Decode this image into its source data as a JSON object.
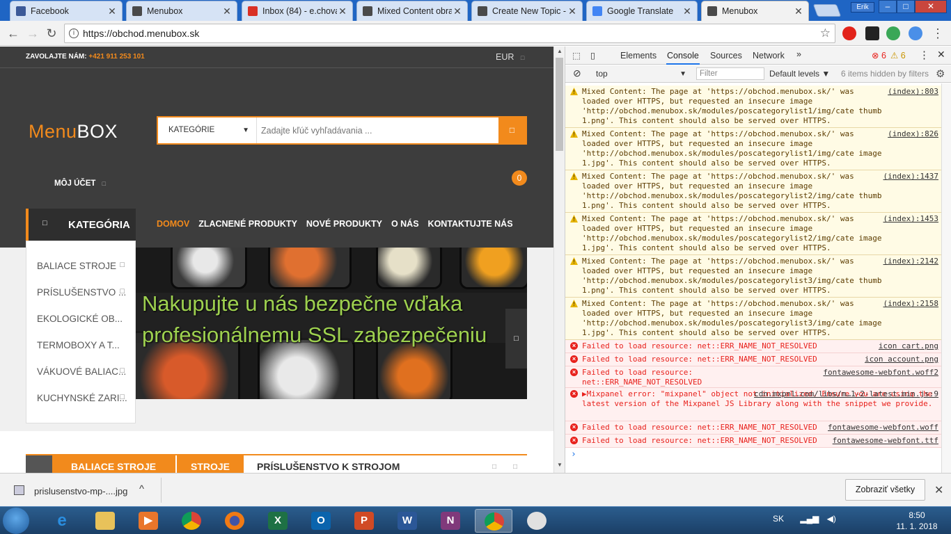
{
  "browser": {
    "tabs": [
      {
        "title": "Facebook",
        "fav_color": "#3b5998",
        "fav_icon": "facebook-icon"
      },
      {
        "title": "Menubox",
        "fav_color": "#4a4a4a",
        "fav_icon": "menubox-icon"
      },
      {
        "title": "Inbox (84) - e.chova",
        "fav_color": "#d93025",
        "fav_icon": "gmail-icon"
      },
      {
        "title": "Mixed Content obra",
        "fav_color": "#4a4a4a",
        "fav_icon": "menubox-icon"
      },
      {
        "title": "Create New Topic -",
        "fav_color": "#4a4a4a",
        "fav_icon": "menubox-icon"
      },
      {
        "title": "Google Translate",
        "fav_color": "#4285f4",
        "fav_icon": "translate-icon"
      },
      {
        "title": "Menubox",
        "fav_color": "#4a4a4a",
        "fav_icon": "menubox-icon",
        "active": true
      }
    ],
    "profile": "Erik",
    "url": "https://obchod.menubox.sk"
  },
  "site": {
    "call_label": "ZAVOLAJTE NÁM:",
    "phone": "+421 911 253 101",
    "currency": "EUR",
    "logo_part1": "Menu",
    "logo_part2": "BOX",
    "search_category": "KATEGÓRIE",
    "search_placeholder": "Zadajte kľúč vyhľadávania ...",
    "account": "MÔJ ÚČET",
    "cart_count": "0",
    "category_header": "KATEGÓRIA",
    "nav": [
      "DOMOV",
      "ZLACNENÉ PRODUKTY",
      "NOVÉ PRODUKTY",
      "O NÁS",
      "KONTAKTUJTE NÁS"
    ],
    "categories": [
      "BALIACE STROJE",
      "PRÍSLUŠENSTVO ...",
      "EKOLOGICKÉ OB...",
      "TERMOBOXY A T...",
      "VÁKUOVÉ BALIAC...",
      "KUCHYNSKÉ ZARI..."
    ],
    "hero_line1": "Nakupujte u nás bezpečne vďaka",
    "hero_line2": "profesionálnemu SSL zabezpečeniu",
    "product_tabs": [
      "BALIACE STROJE",
      "STROJE",
      "PRÍSLUŠENSTVO K STROJOM"
    ],
    "accent": "#f28a1c"
  },
  "devtools": {
    "tabs": [
      "Elements",
      "Console",
      "Sources",
      "Network"
    ],
    "error_count": "6",
    "warning_count": "6",
    "context": "top",
    "filter_placeholder": "Filter",
    "levels": "Default levels",
    "hidden": "6 items hidden by filters",
    "messages": [
      {
        "type": "warn",
        "text": "Mixed Content: The page at 'https://obchod.menubox.sk/' was loaded over HTTPS, but requested an insecure image 'http://obchod.menubox.sk/modules/poscategorylist1/img/cate thumb 1.png'. This content should also be served over HTTPS.",
        "src": "(index):803"
      },
      {
        "type": "warn",
        "text": "Mixed Content: The page at 'https://obchod.menubox.sk/' was loaded over HTTPS, but requested an insecure image 'http://obchod.menubox.sk/modules/poscategorylist1/img/cate image 1.jpg'. This content should also be served over HTTPS.",
        "src": "(index):826"
      },
      {
        "type": "warn",
        "text": "Mixed Content: The page at 'https://obchod.menubox.sk/' was loaded over HTTPS, but requested an insecure image 'http://obchod.menubox.sk/modules/poscategorylist2/img/cate thumb 1.png'. This content should also be served over HTTPS.",
        "src": "(index):1437"
      },
      {
        "type": "warn",
        "text": "Mixed Content: The page at 'https://obchod.menubox.sk/' was loaded over HTTPS, but requested an insecure image 'http://obchod.menubox.sk/modules/poscategorylist2/img/cate image 1.jpg'. This content should also be served over HTTPS.",
        "src": "(index):1453"
      },
      {
        "type": "warn",
        "text": "Mixed Content: The page at 'https://obchod.menubox.sk/' was loaded over HTTPS, but requested an insecure image 'http://obchod.menubox.sk/modules/poscategorylist3/img/cate thumb 1.png'. This content should also be served over HTTPS.",
        "src": "(index):2142"
      },
      {
        "type": "warn",
        "text": "Mixed Content: The page at 'https://obchod.menubox.sk/' was loaded over HTTPS, but requested an insecure image 'http://obchod.menubox.sk/modules/poscategorylist3/img/cate image 1.jpg'. This content should also be served over HTTPS.",
        "src": "(index):2158"
      },
      {
        "type": "err",
        "text": "Failed to load resource: net::ERR_NAME_NOT_RESOLVED",
        "src": "icon cart.png"
      },
      {
        "type": "err",
        "text": "Failed to load resource: net::ERR_NAME_NOT_RESOLVED",
        "src": "icon account.png"
      },
      {
        "type": "err",
        "text": "Failed to load resource: net::ERR_NAME_NOT_RESOLVED",
        "src": "fontawesome-webfont.woff2"
      },
      {
        "type": "err",
        "text": "▶Mixpanel error: \"mixpanel\" object not initialized. Ensure you are using the latest version of the Mixpanel JS Library along with the snippet we provide.",
        "src": "cdn.mxpnl.com/libs/m…1-2-latest.min.js:9"
      },
      {
        "type": "err",
        "text": "Failed to load resource: net::ERR_NAME_NOT_RESOLVED",
        "src": "fontawesome-webfont.woff"
      },
      {
        "type": "err",
        "text": "Failed to load resource: net::ERR_NAME_NOT_RESOLVED",
        "src": "fontawesome-webfont.ttf"
      }
    ]
  },
  "download": {
    "filename": "prislusenstvo-mp-....jpg",
    "show_all": "Zobraziť všetky"
  },
  "taskbar": {
    "lang": "SK",
    "time": "8:50",
    "date": "11. 1. 2018"
  }
}
